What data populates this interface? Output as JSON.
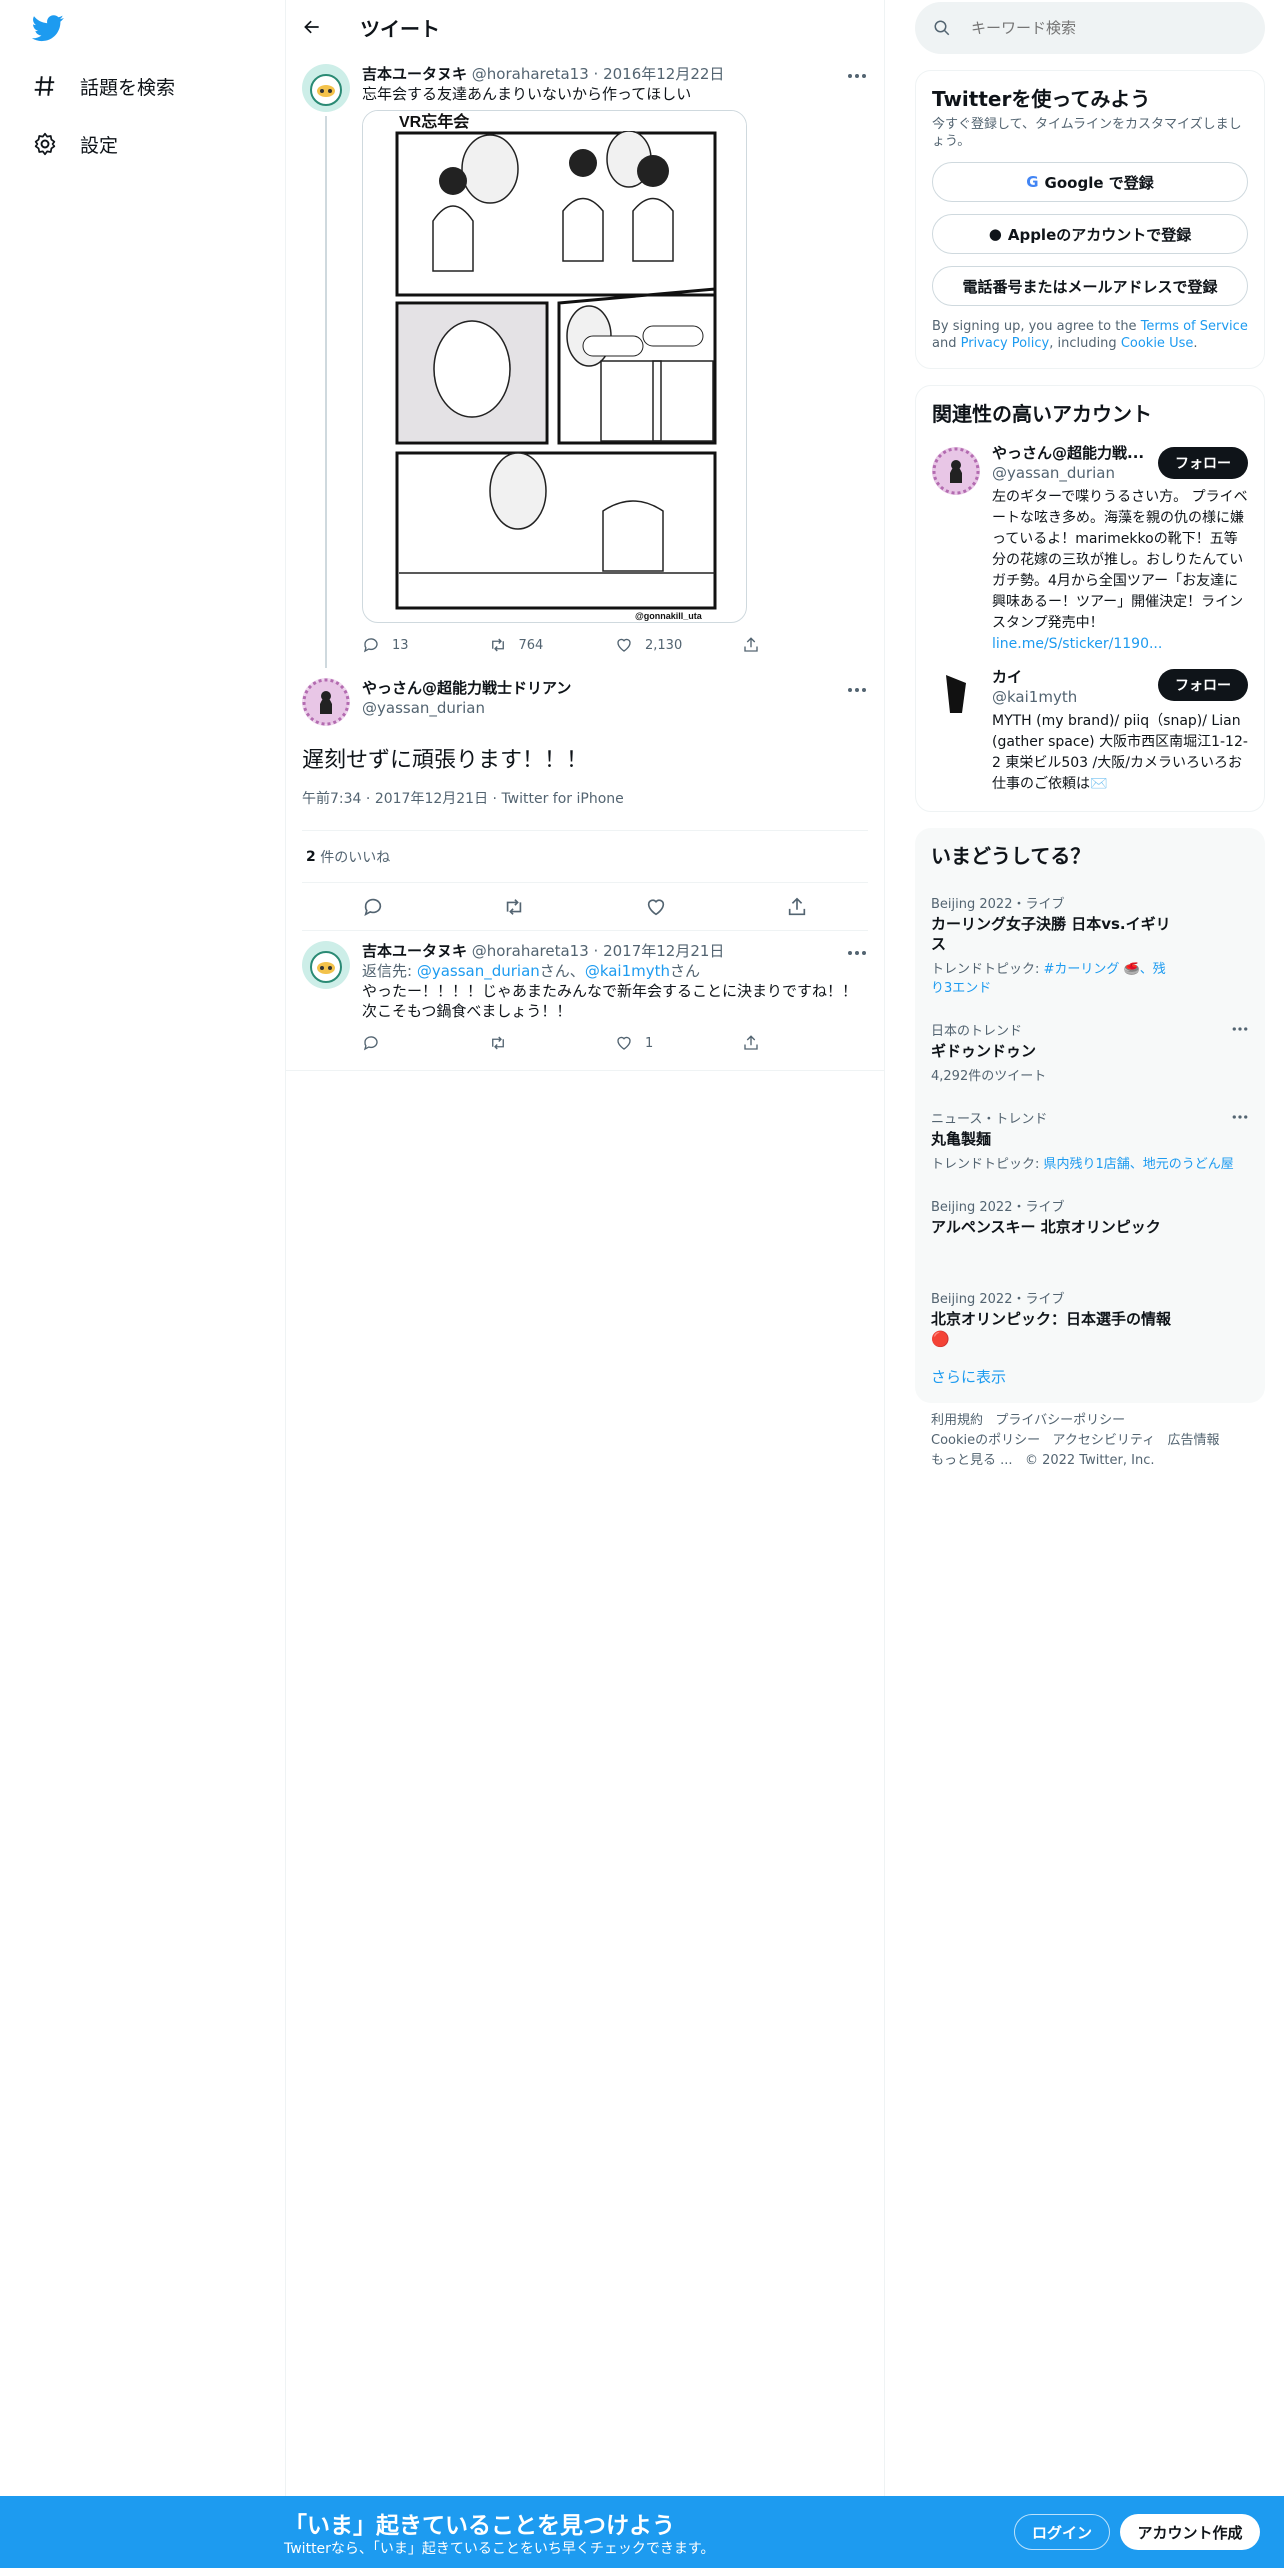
{
  "nav": {
    "explore": "話題を検索",
    "settings": "設定"
  },
  "header": {
    "title": "ツイート"
  },
  "tweet1": {
    "name": "吉本ユータヌキ",
    "handle": "@horahareta13",
    "date": "2016年12月22日",
    "text": "忘年会する友達あんまりいないから作ってほしい",
    "comic_title": "VR忘年会",
    "comic_credit": "@gonnakill_uta",
    "replies": "13",
    "retweets": "764",
    "likes": "2,130"
  },
  "main": {
    "name": "やっさん@超能力戦士ドリアン",
    "handle": "@yassan_durian",
    "text": "遅刻せずに頑張ります！！！",
    "time": "午前7:34",
    "date": "2017年12月21日",
    "source": "Twitter for iPhone",
    "likes_count": "2",
    "likes_label": "件のいいね"
  },
  "tweet3": {
    "name": "吉本ユータヌキ",
    "handle": "@horahareta13",
    "date": "2017年12月21日",
    "reply_prefix": "返信先: ",
    "reply_to1": "@yassan_durian",
    "reply_sep": "さん、",
    "reply_to2": "@kai1myth",
    "reply_suffix": "さん",
    "line1": "やったー！！！！じゃあまたみんなで新年会することに決まりですね！！",
    "line2": "次こそもつ鍋食べましょう！！",
    "likes": "1"
  },
  "search": {
    "placeholder": "キーワード検索"
  },
  "signup": {
    "title": "Twitterを使ってみよう",
    "sub": "今すぐ登録して、タイムラインをカスタマイズしましょう。",
    "google": "Google で登録",
    "apple": "Appleのアカウントで登録",
    "phone": "電話番号またはメールアドレスで登録",
    "legal_pre": "By signing up, you agree to the ",
    "tos": "Terms of Service",
    "and": " and ",
    "privacy": "Privacy Policy",
    "including": ", including ",
    "cookie": "Cookie Use",
    "dot": "."
  },
  "related": {
    "title": "関連性の高いアカウント",
    "follow": "フォロー",
    "accounts": [
      {
        "name": "やっさん@超能力戦...",
        "handle": "@yassan_durian",
        "bio": "左のギターで喋りうるさい方。 プライベートな呟き多め。海藻を親の仇の様に嫌っているよ！marimekkoの靴下！五等分の花嫁の三玖が推し。おしりたんていガチ勢。4月から全国ツアー「お友達に興味あるー！ツアー」開催決定！ラインスタンプ発売中！",
        "link": "line.me/S/sticker/1190..."
      },
      {
        "name": "カイ",
        "handle": "@kai1myth",
        "bio": "MYTH (my brand)/ piiq（snap)/ Lian (gather space) 大阪市西区南堀江1-12-2 東栄ビル503 /大阪/カメラいろいろお仕事のご依頼は✉️"
      }
    ]
  },
  "trends": {
    "title": "いまどうしてる？",
    "items": [
      {
        "meta": "Beijing 2022・ライブ",
        "name": "カーリング女子決勝 日本vs.イギリス",
        "sub_prefix": "トレンドトピック: ",
        "sub_link": "#カーリング 🥌、残り3エンド"
      },
      {
        "meta": "日本のトレンド",
        "name": "ギドゥンドゥン",
        "sub": "4,292件のツイート"
      },
      {
        "meta": "ニュース・トレンド",
        "name": "丸亀製麺",
        "sub_prefix": "トレンドトピック: ",
        "sub_link": "県内残り1店舗、地元のうどん屋"
      },
      {
        "meta": "Beijing 2022・ライブ",
        "name": "アルペンスキー 北京オリンピック"
      },
      {
        "meta": "Beijing 2022・ライブ",
        "name": "北京オリンピック：日本選手の情報 🔴"
      }
    ],
    "show_more": "さらに表示"
  },
  "footer": {
    "tos": "利用規約",
    "privacy": "プライバシーポリシー",
    "cookie": "Cookieのポリシー",
    "access": "アクセシビリティ",
    "ads": "広告情報",
    "more": "もっと見る ...",
    "copy": "© 2022 Twitter, Inc."
  },
  "banner": {
    "title": "「いま」起きていることを見つけよう",
    "sub": "Twitterなら、「いま」起きていることをいち早くチェックできます。",
    "login": "ログイン",
    "signup": "アカウント作成"
  },
  "colors": {
    "accent": "#1d9bf0",
    "text": "#0f1419",
    "muted": "#536471",
    "border": "#eff3f4"
  }
}
